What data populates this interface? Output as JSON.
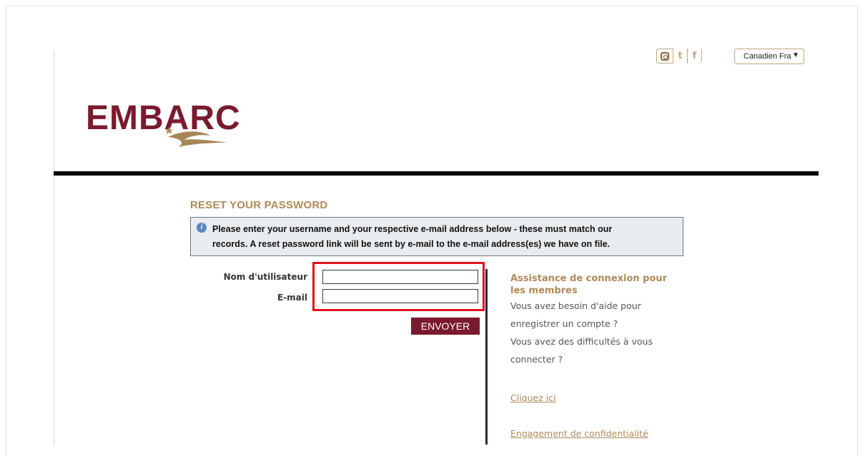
{
  "header": {
    "social": {
      "instagram": "instagram-icon",
      "twitter": "t",
      "facebook": "f"
    },
    "language": {
      "selected": "Canadien Fra",
      "arrow": "▼"
    }
  },
  "brand": {
    "logo_text": "EMBARC"
  },
  "reset": {
    "title": "RESET YOUR PASSWORD",
    "info_line1": "Please enter your username and your respective e-mail address below - these must match our",
    "info_line2": "records. A reset password link will be sent by e-mail to the e-mail address(es) we have on file.",
    "info_icon": "i",
    "username_label": "Nom d'utilisateur",
    "username_value": "",
    "email_label": "E-mail",
    "email_value": "",
    "submit_label": "ENVOYER"
  },
  "assistance": {
    "heading_line1": "Assistance de connexion pour",
    "heading_line2": "les membres",
    "text_line1": "Vous avez besoin d'aide pour",
    "text_line2": "enregistrer un compte ?",
    "text_line3": "Vous avez des difficultés à vous",
    "text_line4": "connecter ?",
    "link_click": "Cliquez ici",
    "link_privacy": "Engagement de confidentialité"
  },
  "colors": {
    "brand": "#7a1a2f",
    "gold": "#b08a58",
    "highlight": "#e0131f"
  }
}
